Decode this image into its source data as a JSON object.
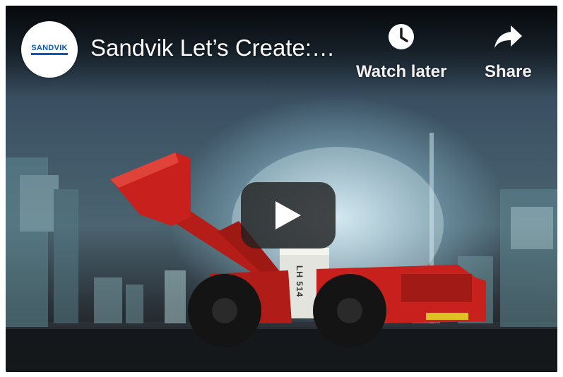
{
  "video": {
    "title": "Sandvik Let’s Create:…",
    "channel_logo_text": "SANDVIK",
    "loader_plate_text": "LH 514"
  },
  "actions": {
    "watch_later_label": "Watch later",
    "share_label": "Share"
  },
  "icons": {
    "watch_later": "clock-icon",
    "share": "share-arrow-icon",
    "play": "play-icon"
  },
  "colors": {
    "loader_red": "#c8201c",
    "logo_blue": "#0a5ab4",
    "play_bg": "#212121"
  }
}
